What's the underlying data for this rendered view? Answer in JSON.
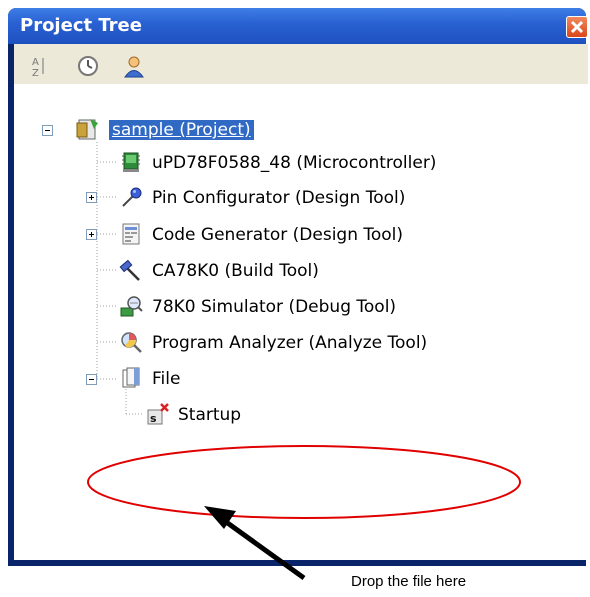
{
  "window": {
    "title": "Project Tree"
  },
  "toolbar": {
    "icons": [
      "sort-alpha-icon",
      "clock-icon",
      "user-icon"
    ]
  },
  "tree": {
    "root_label": "sample (Project)",
    "items": [
      {
        "label": "uPD78F0588_48 (Microcontroller)",
        "icon": "microcontroller-icon"
      },
      {
        "label": "Pin Configurator (Design Tool)",
        "icon": "pin-configurator-icon"
      },
      {
        "label": "Code Generator (Design Tool)",
        "icon": "code-generator-icon"
      },
      {
        "label": "CA78K0 (Build Tool)",
        "icon": "hammer-icon"
      },
      {
        "label": "78K0 Simulator (Debug Tool)",
        "icon": "simulator-icon"
      },
      {
        "label": "Program Analyzer (Analyze Tool)",
        "icon": "analyzer-icon"
      },
      {
        "label": "File",
        "icon": "folder-icon"
      }
    ],
    "file_children": [
      {
        "label": "Startup",
        "icon": "startup-file-icon"
      }
    ]
  },
  "annotation": {
    "text": "Drop the file here"
  },
  "colors": {
    "title_bar": "#2a62d3",
    "selection": "#316ac5",
    "annotation_ellipse": "#e00000"
  }
}
